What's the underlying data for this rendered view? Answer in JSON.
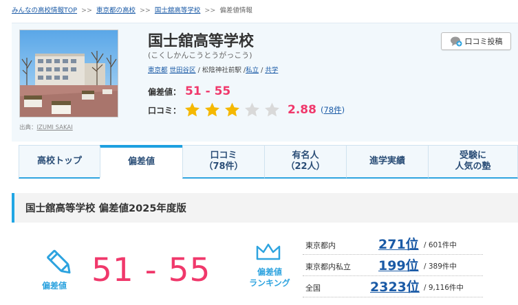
{
  "breadcrumb": {
    "items": [
      "みんなの高校情報TOP",
      "東京都の高校",
      "国士舘高等学校"
    ],
    "current": "偏差値情報",
    "separator": ">>"
  },
  "school": {
    "name": "国士舘高等学校",
    "kana": "(こくしかんこうとうがっこう)",
    "pref": "東京都",
    "city": "世田谷区",
    "station": "松陰神社前駅",
    "type": "私立",
    "gender": "共学",
    "slash": "/"
  },
  "photo": {
    "caption_prefix": "出典：",
    "caption_author": "IZUMI SAKAI"
  },
  "deviation": {
    "label": "偏差値：",
    "value": "51 - 55"
  },
  "review": {
    "label": "口コミ：",
    "stars_filled": 3,
    "stars_total": 5,
    "score": "2.88",
    "count": "78件",
    "open_paren": "(",
    "close_paren": ")"
  },
  "buttons": {
    "kuchikomi": "口コミ投稿"
  },
  "tabs": [
    {
      "line1": "高校トップ",
      "line2": ""
    },
    {
      "line1": "偏差値",
      "line2": ""
    },
    {
      "line1": "口コミ",
      "line2": "（78件）"
    },
    {
      "line1": "有名人",
      "line2": "（22人）"
    },
    {
      "line1": "進学実績",
      "line2": ""
    },
    {
      "line1": "受験に",
      "line2": "人気の塾"
    }
  ],
  "section": {
    "title": "国士舘高等学校 偏差値2025年度版"
  },
  "big": {
    "label": "偏差値",
    "value": "51 - 55",
    "ranking_label_1": "偏差値",
    "ranking_label_2": "ランキング"
  },
  "ranking": [
    {
      "area": "東京都内",
      "rank": "271位",
      "total": "/ 601件中"
    },
    {
      "area": "東京都内私立",
      "rank": "199位",
      "total": "/ 389件中"
    },
    {
      "area": "全国",
      "rank": "2323位",
      "total": "/ 9,116件中"
    }
  ],
  "colors": {
    "accent_blue": "#2da3df",
    "pink": "#f0386b",
    "link": "#1a5aa6",
    "star": "#f5b800"
  },
  "icons": [
    "chat-plus-icon",
    "star-icon",
    "pencil-icon",
    "crown-icon"
  ]
}
